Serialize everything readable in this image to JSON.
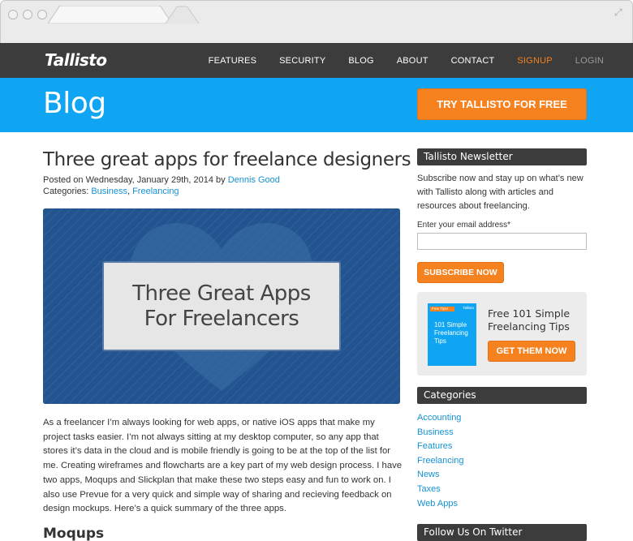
{
  "nav": {
    "logo": "Tallisto",
    "items": [
      {
        "label": "FEATURES"
      },
      {
        "label": "SECURITY"
      },
      {
        "label": "BLOG"
      },
      {
        "label": "ABOUT"
      },
      {
        "label": "CONTACT"
      },
      {
        "label": "SIGNUP"
      },
      {
        "label": "LOGIN"
      }
    ]
  },
  "hero": {
    "title": "Blog",
    "cta": "TRY TALLISTO FOR FREE"
  },
  "post": {
    "title": "Three great apps for freelance designers",
    "posted_prefix": "Posted on Wednesday, January 29th, 2014 by ",
    "author": "Dennis Good",
    "categories_prefix": "Categories: ",
    "categories": [
      "Business",
      "Freelancing"
    ],
    "category_separator": ", ",
    "image_text_line1": "Three Great Apps",
    "image_text_line2": "For Freelancers",
    "body": "As a freelancer I’m always looking for web apps, or native iOS apps that make my project tasks easier. I’m not always sitting at my desktop computer, so any app that stores it’s data in the cloud and is mobile friendly is going to be at the top of the list for me. Creating wireframes and flowcharts are a key part of my web design process. I have two apps, Moqups and Slickplan that make these two steps easy and fun to work on. I also use Prevue for a very quick and simple way of sharing and recieving feedback on design mockups. Here’s a quick summary of the three apps.",
    "subheading": "Moqups"
  },
  "sidebar": {
    "newsletter": {
      "heading": "Tallisto Newsletter",
      "text": "Subscribe now and stay up on what’s new with Tallisto along with articles and resources about freelancing.",
      "email_label": "Enter your email address*",
      "email_value": "",
      "subscribe": "SUBSCRIBE NOW"
    },
    "tips": {
      "ebook_tag": "Free Tips!",
      "ebook_brand": "Tallisto",
      "ebook_title": "101 Simple Freelancing Tips",
      "title": "Free 101 Simple Freelancing Tips",
      "button": "GET THEM NOW"
    },
    "categories": {
      "heading": "Categories",
      "items": [
        "Accounting",
        "Business",
        "Features",
        "Freelancing",
        "News",
        "Taxes",
        "Web Apps"
      ]
    },
    "twitter": {
      "heading": "Follow Us On Twitter"
    }
  },
  "colors": {
    "nav_bg": "#3c3c3c",
    "hero_bg": "#10a5f2",
    "accent_orange": "#f5821f",
    "link_blue": "#1592d3",
    "feature_bg": "#23548f"
  }
}
